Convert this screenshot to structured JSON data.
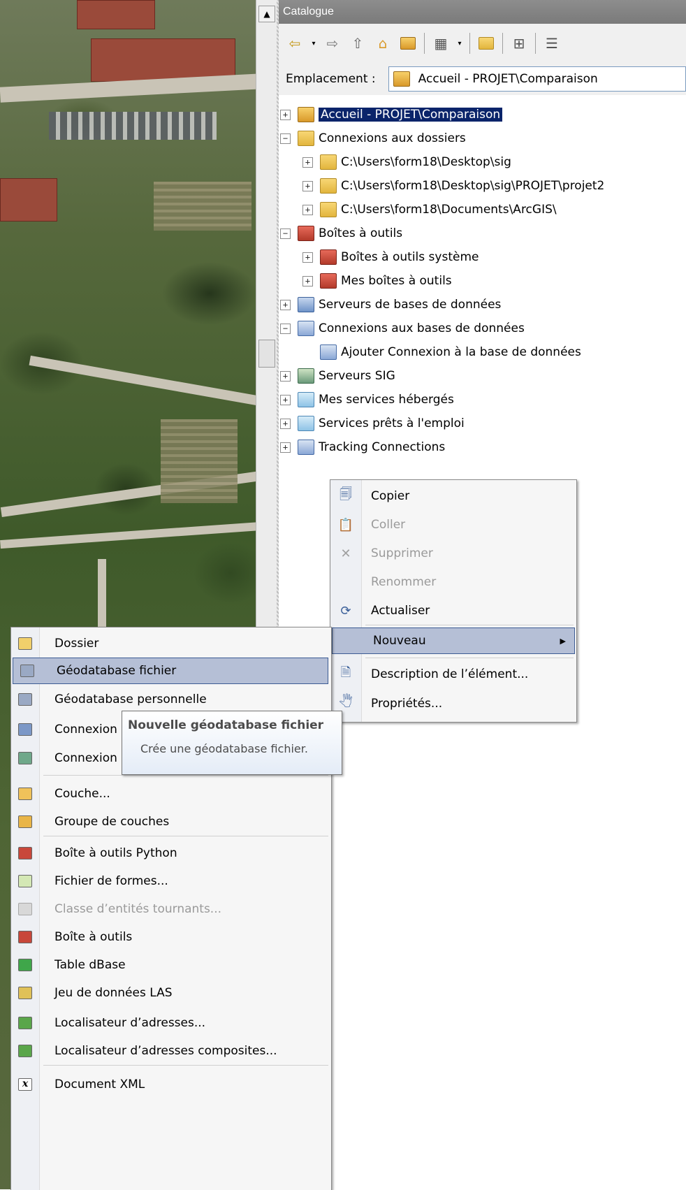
{
  "catalogue": {
    "title": "Catalogue",
    "location_label": "Emplacement :",
    "location_value": "Accueil - PROJET\\Comparaison"
  },
  "toolbar": {
    "icons": [
      "back-arrow-icon",
      "dropdown-arrow-icon",
      "forward-arrow-icon",
      "up-folder-icon",
      "home-folder-icon",
      "connect-folder-icon",
      "views-icon",
      "dropdown-arrow-icon",
      "new-folder-icon",
      "tree-view-icon",
      "details-icon"
    ]
  },
  "tree": [
    {
      "label": "Accueil - PROJET\\Comparaison",
      "exp": "+",
      "icon": "home",
      "level": 0,
      "selected": true
    },
    {
      "label": "Connexions aux dossiers",
      "exp": "−",
      "icon": "folder",
      "level": 0
    },
    {
      "label": "C:\\Users\\form18\\Desktop\\sig",
      "exp": "+",
      "icon": "folder",
      "level": 1
    },
    {
      "label": "C:\\Users\\form18\\Desktop\\sig\\PROJET\\projet2",
      "exp": "+",
      "icon": "folder",
      "level": 1
    },
    {
      "label": "C:\\Users\\form18\\Documents\\ArcGIS\\",
      "exp": "+",
      "icon": "folder",
      "level": 1
    },
    {
      "label": "Boîtes à outils",
      "exp": "−",
      "icon": "toolbox",
      "level": 0
    },
    {
      "label": "Boîtes à outils système",
      "exp": "+",
      "icon": "toolbox",
      "level": 1
    },
    {
      "label": "Mes boîtes à outils",
      "exp": "+",
      "icon": "toolbox",
      "level": 1
    },
    {
      "label": "Serveurs de bases de données",
      "exp": "+",
      "icon": "dbsrv",
      "level": 0
    },
    {
      "label": "Connexions aux bases de données",
      "exp": "−",
      "icon": "dbconn",
      "level": 0
    },
    {
      "label": "Ajouter Connexion à la base de données",
      "exp": "",
      "icon": "dbconn",
      "level": 1
    },
    {
      "label": "Serveurs SIG",
      "exp": "+",
      "icon": "gis",
      "level": 0
    },
    {
      "label": "Mes services hébergés",
      "exp": "+",
      "icon": "svc",
      "level": 0
    },
    {
      "label": "Services prêts à l'emploi",
      "exp": "+",
      "icon": "svc",
      "level": 0
    },
    {
      "label": "Tracking Connections",
      "exp": "+",
      "icon": "dbconn",
      "level": 0
    }
  ],
  "context_menu": {
    "items": [
      {
        "label": "Copier",
        "icon": "copy-icon",
        "glyph": "🗐",
        "disabled": false
      },
      {
        "label": "Coller",
        "icon": "paste-icon",
        "glyph": "📋",
        "disabled": true
      },
      {
        "label": "Supprimer",
        "icon": "delete-icon",
        "glyph": "✕",
        "disabled": true
      },
      {
        "label": "Renommer",
        "icon": "",
        "glyph": "",
        "disabled": true
      },
      {
        "label": "Actualiser",
        "icon": "refresh-icon",
        "glyph": "⟳",
        "disabled": false
      },
      {
        "label": "Nouveau",
        "icon": "",
        "glyph": "",
        "disabled": false,
        "highlighted": true,
        "submenu": true
      },
      {
        "label": "Description de l’élément...",
        "icon": "description-icon",
        "glyph": "🗎",
        "disabled": false
      },
      {
        "label": "Propriétés...",
        "icon": "properties-icon",
        "glyph": "🖑",
        "disabled": false
      }
    ]
  },
  "submenu": {
    "items": [
      {
        "label": "Dossier",
        "icon": "folder-icon",
        "color": "#f1d06b",
        "disabled": false
      },
      {
        "label": "Géodatabase fichier",
        "icon": "file-geodatabase-icon",
        "color": "#9aa9c4",
        "disabled": false,
        "highlighted": true
      },
      {
        "label": "Géodatabase personnelle",
        "icon": "personal-geodatabase-icon",
        "color": "#9aa9c4",
        "disabled": false
      },
      {
        "label": "Connexion",
        "icon": "database-connection-icon",
        "color": "#7c98c7",
        "disabled": false
      },
      {
        "label": "Connexion",
        "icon": "server-connection-icon",
        "color": "#6fa88a",
        "disabled": false
      },
      {
        "label": "Couche...",
        "icon": "layer-icon",
        "color": "#f0c25a",
        "disabled": false
      },
      {
        "label": "Groupe de couches",
        "icon": "group-layer-icon",
        "color": "#e9b547",
        "disabled": false
      },
      {
        "label": "Boîte à outils Python",
        "icon": "python-toolbox-icon",
        "color": "#c8473a",
        "disabled": false
      },
      {
        "label": "Fichier de formes...",
        "icon": "shapefile-icon",
        "color": "#d4e8b5",
        "disabled": false
      },
      {
        "label": "Classe d’entités tournants...",
        "icon": "turn-feature-class-icon",
        "color": "#d8d8d8",
        "disabled": true
      },
      {
        "label": "Boîte à outils",
        "icon": "toolbox-icon",
        "color": "#c8473a",
        "disabled": false
      },
      {
        "label": "Table dBase",
        "icon": "dbase-table-icon",
        "color": "#3fa64a",
        "disabled": false
      },
      {
        "label": "Jeu de données LAS",
        "icon": "las-dataset-icon",
        "color": "#e0c158",
        "disabled": false
      },
      {
        "label": "Localisateur d’adresses...",
        "icon": "address-locator-icon",
        "color": "#5aa64a",
        "disabled": false
      },
      {
        "label": "Localisateur d’adresses composites...",
        "icon": "composite-address-locator-icon",
        "color": "#5aa64a",
        "disabled": false
      },
      {
        "label": "Document XML",
        "icon": "xml-document-icon",
        "color": "#ffffff",
        "disabled": false
      }
    ]
  },
  "tooltip": {
    "title": "Nouvelle géodatabase fichier",
    "body": "Crée une géodatabase fichier."
  }
}
